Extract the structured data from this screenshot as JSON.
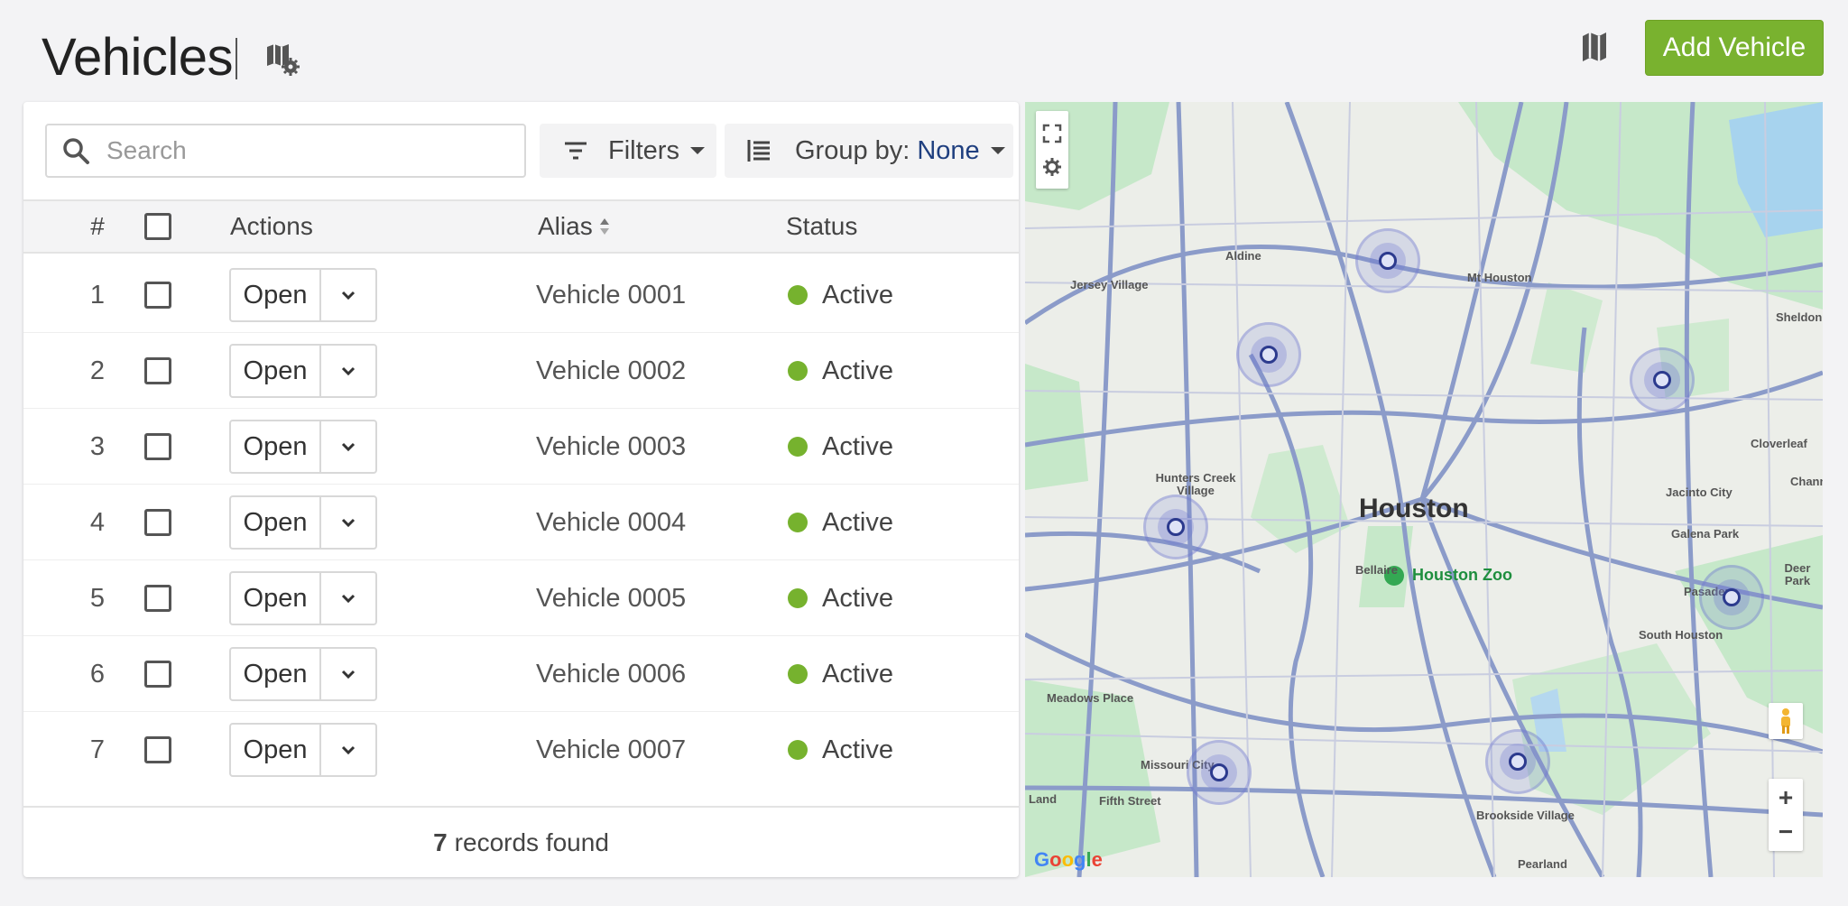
{
  "header": {
    "title": "Vehicles",
    "add_button": "Add Vehicle"
  },
  "toolbar": {
    "search_placeholder": "Search",
    "filters_label": "Filters",
    "group_by_label": "Group by:",
    "group_by_value": "None"
  },
  "table": {
    "columns": {
      "num": "#",
      "actions": "Actions",
      "alias": "Alias",
      "status": "Status"
    },
    "rows": [
      {
        "num": "1",
        "action": "Open",
        "alias": "Vehicle 0001",
        "status": "Active"
      },
      {
        "num": "2",
        "action": "Open",
        "alias": "Vehicle 0002",
        "status": "Active"
      },
      {
        "num": "3",
        "action": "Open",
        "alias": "Vehicle 0003",
        "status": "Active"
      },
      {
        "num": "4",
        "action": "Open",
        "alias": "Vehicle 0004",
        "status": "Active"
      },
      {
        "num": "5",
        "action": "Open",
        "alias": "Vehicle 0005",
        "status": "Active"
      },
      {
        "num": "6",
        "action": "Open",
        "alias": "Vehicle 0006",
        "status": "Active"
      },
      {
        "num": "7",
        "action": "Open",
        "alias": "Vehicle 0007",
        "status": "Active"
      }
    ],
    "footer_count": "7",
    "footer_text": "records found"
  },
  "map": {
    "city": "Houston",
    "zoo": "Houston Zoo",
    "labels": [
      "Aldine",
      "Jersey Village",
      "Mt Houston",
      "Sheldon",
      "Cloverleaf",
      "Channelview",
      "Jacinto City",
      "Galena Park",
      "Deer Park",
      "Pasadena",
      "South Houston",
      "Bellaire",
      "Meadows Place",
      "Missouri City",
      "Fifth Street",
      "Brookside Village",
      "Pearland",
      "Hunters Creek Village",
      "Land"
    ],
    "zoom_in": "+",
    "zoom_out": "−",
    "attribution": "Google"
  },
  "colors": {
    "accent_green": "#79b22f",
    "status_active": "#76b22e",
    "group_value": "#1f3f7f",
    "marker": "#2c3a8e"
  },
  "icons": {
    "search": "search-icon",
    "filter": "filter-icon",
    "group": "group-list-icon",
    "map_settings": "map-settings-icon",
    "map": "map-icon",
    "fullscreen": "fullscreen-icon",
    "gear": "gear-icon",
    "pegman": "pegman-icon"
  }
}
